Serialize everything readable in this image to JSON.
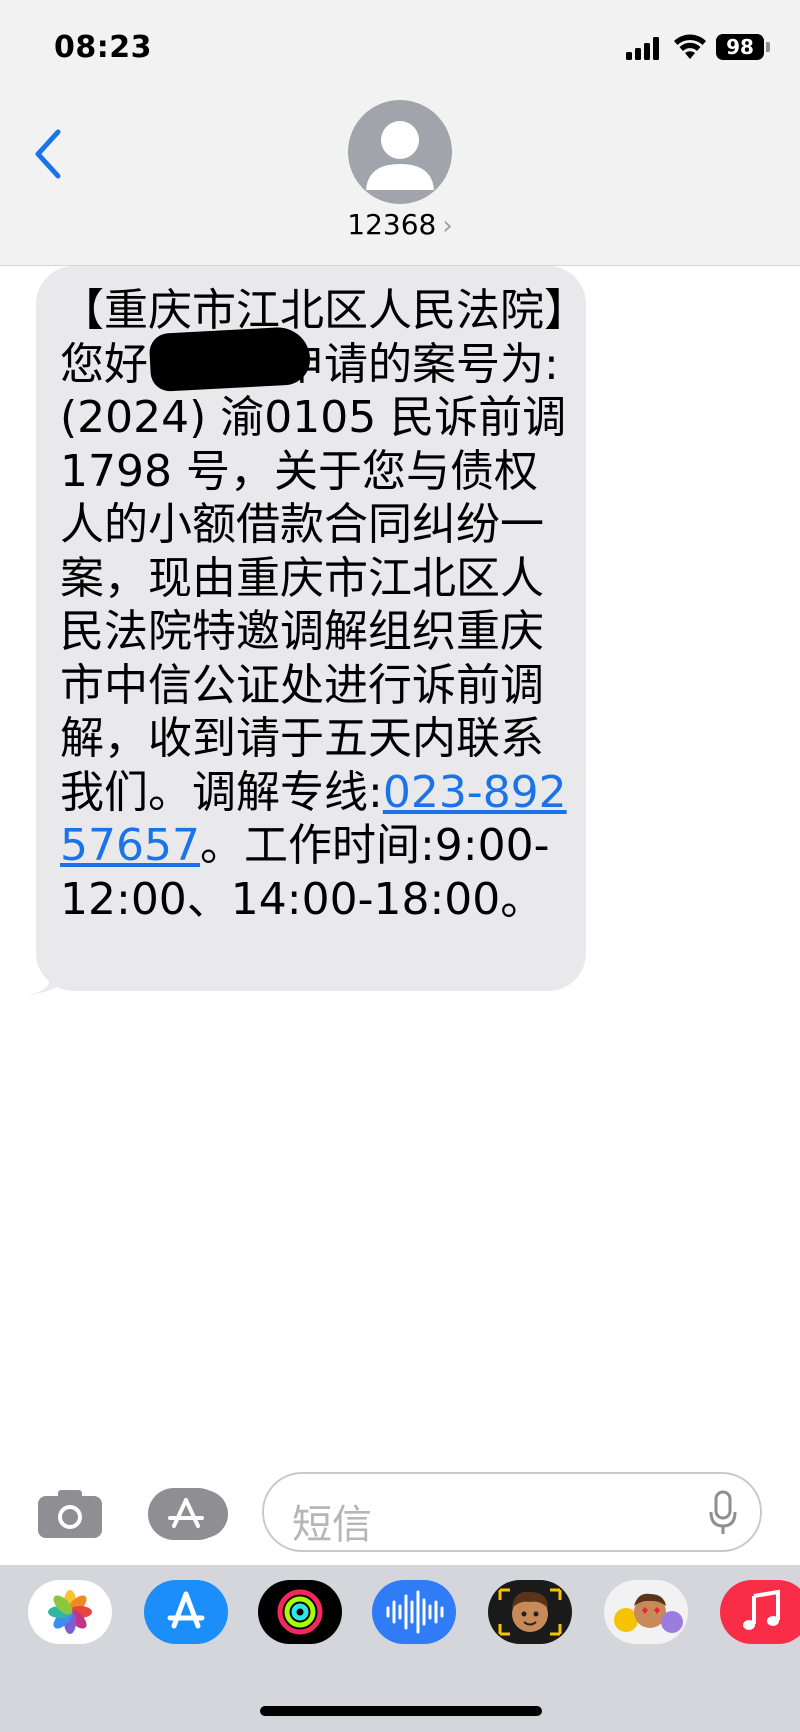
{
  "status_bar": {
    "time": "08:23",
    "battery": "98"
  },
  "header": {
    "contact": "12368",
    "chevron": "›"
  },
  "message": {
    "text_before_link": "【重庆市江北区人民法院】您好，您被申请的案号为:(2024) 渝0105 民诉前调 1798 号，关于您与债权人的小额借款合同纠纷一案，现由重庆市江北区人民法院特邀调解组织重庆市中信公证处进行诉前调解，收到请于五天内联系我们。调解专线:",
    "link": "023-89257657",
    "text_after_link": "。工作时间:9:00-12:00、14:00-18:00。"
  },
  "input": {
    "placeholder": "短信"
  },
  "apps": [
    {
      "icon": "photos-icon",
      "color": "#ffffff"
    },
    {
      "icon": "app-store-icon",
      "color": "#1c8ef9"
    },
    {
      "icon": "activity-icon",
      "color": "#000000"
    },
    {
      "icon": "audio-message-icon",
      "color": "#2f7cf6"
    },
    {
      "icon": "memoji-icon",
      "color": "#1a1a1a"
    },
    {
      "icon": "memoji-stickers-icon",
      "color": "#f2f2f2"
    },
    {
      "icon": "music-icon",
      "color": "#fa2d48"
    }
  ],
  "colors": {
    "header_bg": "#f2f2f3",
    "bubble_bg": "#e9e9eb",
    "link": "#1a73e8",
    "back_chevron": "#1a73e8"
  }
}
